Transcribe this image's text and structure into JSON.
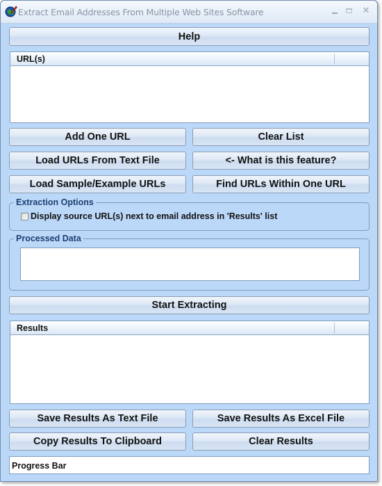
{
  "window": {
    "title": "Extract Email Addresses From Multiple Web Sites Software",
    "icon": "app-globe-pen-icon",
    "controls": {
      "minimize": "minimize-icon",
      "maximize": "maximize-icon",
      "close": "✕"
    }
  },
  "buttons": {
    "help": "Help",
    "add_one_url": "Add One URL",
    "clear_list": "Clear List",
    "load_urls_from_text_file": "Load URLs From Text File",
    "what_is_this_feature": "<- What is this feature?",
    "load_sample_urls": "Load Sample/Example URLs",
    "find_urls_within_one_url": "Find URLs Within One URL",
    "start_extracting": "Start Extracting",
    "save_results_text": "Save Results As Text File",
    "save_results_excel": "Save Results As Excel File",
    "copy_results_clipboard": "Copy Results To Clipboard",
    "clear_results": "Clear Results"
  },
  "url_list": {
    "column_header": "URL(s)",
    "items": []
  },
  "extraction_options": {
    "legend": "Extraction Options",
    "display_source_url": {
      "label": "Display source URL(s) next to email address in 'Results' list",
      "checked": false
    }
  },
  "processed_data": {
    "legend": "Processed Data",
    "value": ""
  },
  "results_list": {
    "column_header": "Results",
    "items": []
  },
  "progress_bar": {
    "label": "Progress Bar",
    "value_percent": 0
  }
}
